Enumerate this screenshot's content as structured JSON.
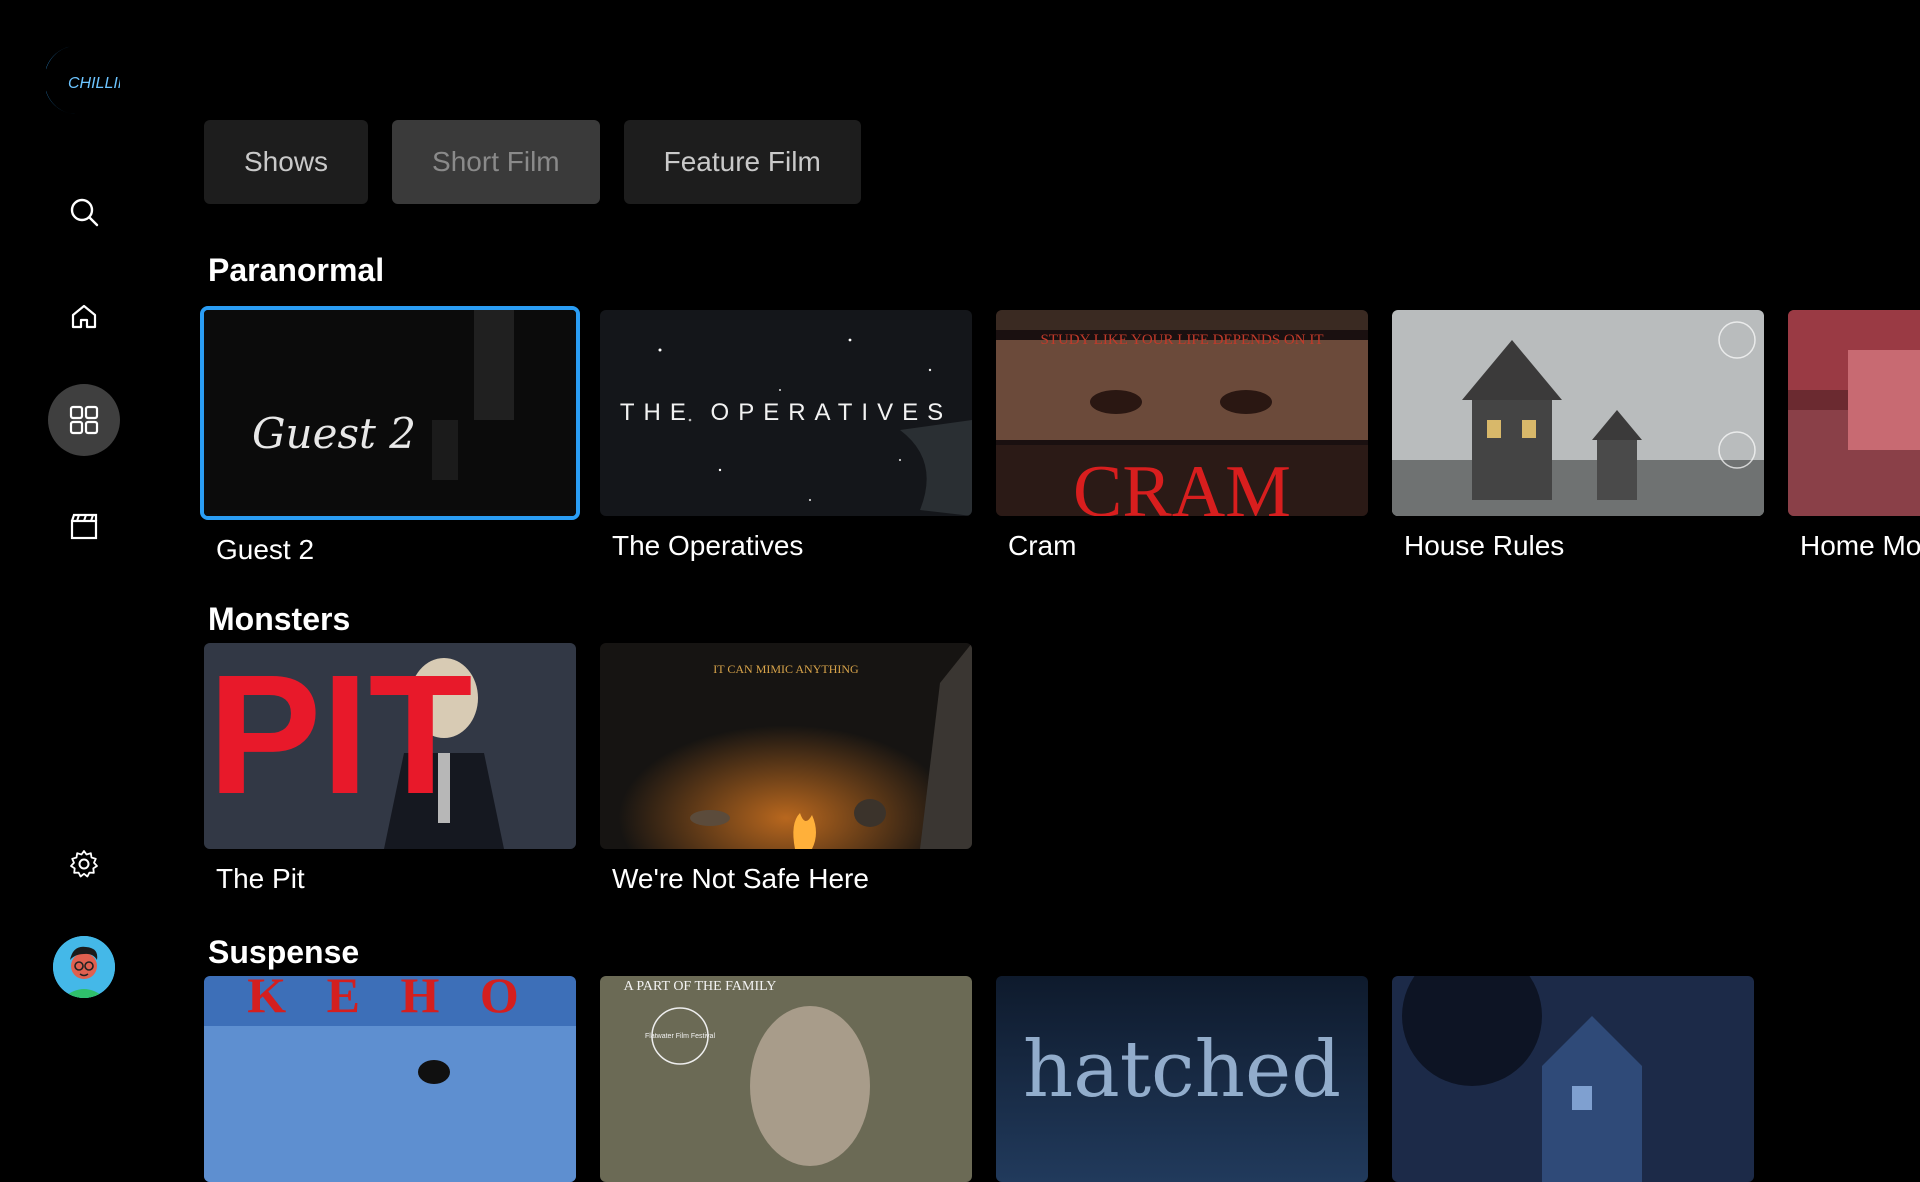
{
  "brand": {
    "logo_text": "CHILLING"
  },
  "sidebar": {
    "items": [
      {
        "icon": "search-icon"
      },
      {
        "icon": "home-icon"
      },
      {
        "icon": "grid-icon",
        "active": true
      },
      {
        "icon": "clapperboard-icon"
      },
      {
        "icon": "gear-icon"
      }
    ]
  },
  "tabs": [
    {
      "label": "Shows"
    },
    {
      "label": "Short Film",
      "selected": true
    },
    {
      "label": "Feature Film"
    }
  ],
  "rows": [
    {
      "title": "Paranormal",
      "items": [
        {
          "title": "Guest 2",
          "poster_text": "Guest 2",
          "focused": true
        },
        {
          "title": "The Operatives",
          "poster_text": "THE OPERATIVES"
        },
        {
          "title": "Cram",
          "poster_text": "CRAM",
          "poster_subtext": "STUDY LIKE YOUR LIFE DEPENDS ON IT"
        },
        {
          "title": "House Rules"
        },
        {
          "title": "Home Mo"
        }
      ]
    },
    {
      "title": "Monsters",
      "items": [
        {
          "title": "The Pit",
          "poster_text": "PIT"
        },
        {
          "title": "We're Not Safe Here",
          "poster_subtext": "IT CAN MIMIC ANYTHING"
        }
      ]
    },
    {
      "title": "Suspense",
      "items": [
        {
          "poster_text": "K E H O"
        },
        {
          "poster_subtext": "A PART OF THE FAMILY",
          "poster_laurel": "Flatwater Film Festival"
        },
        {
          "poster_text": "hatched"
        },
        {}
      ]
    }
  ],
  "colors": {
    "focus": "#2a9df4",
    "background": "#000000",
    "tab_bg": "#1d1d1d"
  }
}
